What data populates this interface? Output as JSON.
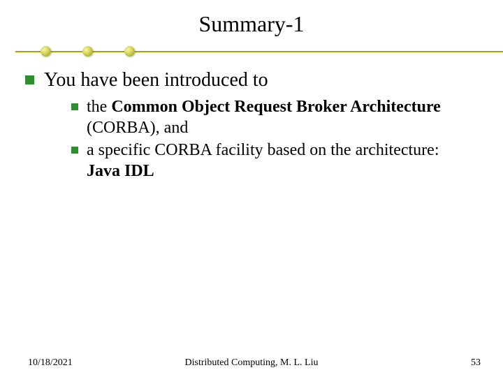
{
  "title": "Summary-1",
  "l1": "You have been introduced to",
  "sub1": {
    "lead": " the ",
    "bold": "Common Object Request Broker Architecture",
    "tail": " (CORBA), and"
  },
  "sub2": {
    "lead": "a specific CORBA facility based on the architecture: ",
    "bold": "Java IDL",
    "tail": ""
  },
  "footer": {
    "date": "10/18/2021",
    "mid": "Distributed Computing, M. L. Liu",
    "page": "53"
  },
  "colors": {
    "bullet": "#2f8f2f",
    "rule": "#a6a600"
  }
}
